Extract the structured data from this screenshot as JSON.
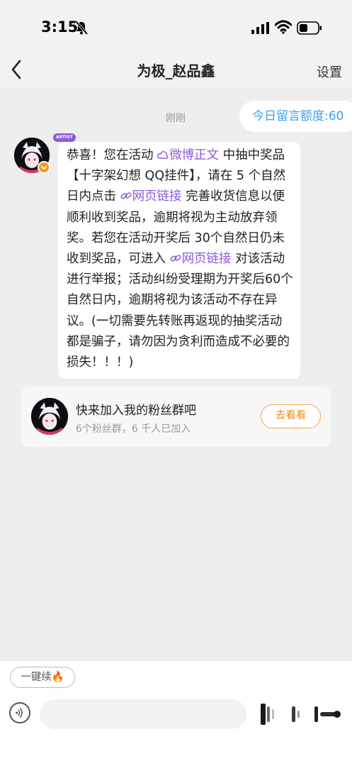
{
  "status_bar": {
    "time": "3:15"
  },
  "header": {
    "title": "为极_赵品鑫",
    "settings_label": "设置"
  },
  "chat": {
    "timestamp": "刚刚",
    "quota_label": "今日留言额度:60",
    "sender_badge": "ARTIST",
    "message": {
      "p1": "恭喜！您在活动 ",
      "link1": "微博正文",
      "p2": " 中抽中奖品【十字架幻想 QQ挂件】，请在 5 个自然日内点击 ",
      "link2": "网页链接",
      "p3": " 完善收货信息以便顺利收到奖品，逾期将视为主动放弃领奖。若您在活动开奖后 30个自然日仍未收到奖品，可进入 ",
      "link3": "网页链接",
      "p4": " 对该活动进行举报；活动纠纷受理期为开奖后60个自然日内，逾期将视为该活动不存在异议。(一切需要先转账再返现的抽奖活动都是骗子，请勿因为贪利而造成不必要的损失！！！)"
    },
    "fan_group": {
      "title": "快来加入我的粉丝群吧",
      "subtitle": "6个粉丝群，6 千人已加入",
      "button": "去看看"
    }
  },
  "composer": {
    "quick_reply": "一键续🔥",
    "input_placeholder": ""
  },
  "colors": {
    "link": "#8a5bd8",
    "quota": "#3b9ff0",
    "fan_button": "#f08a1c"
  }
}
